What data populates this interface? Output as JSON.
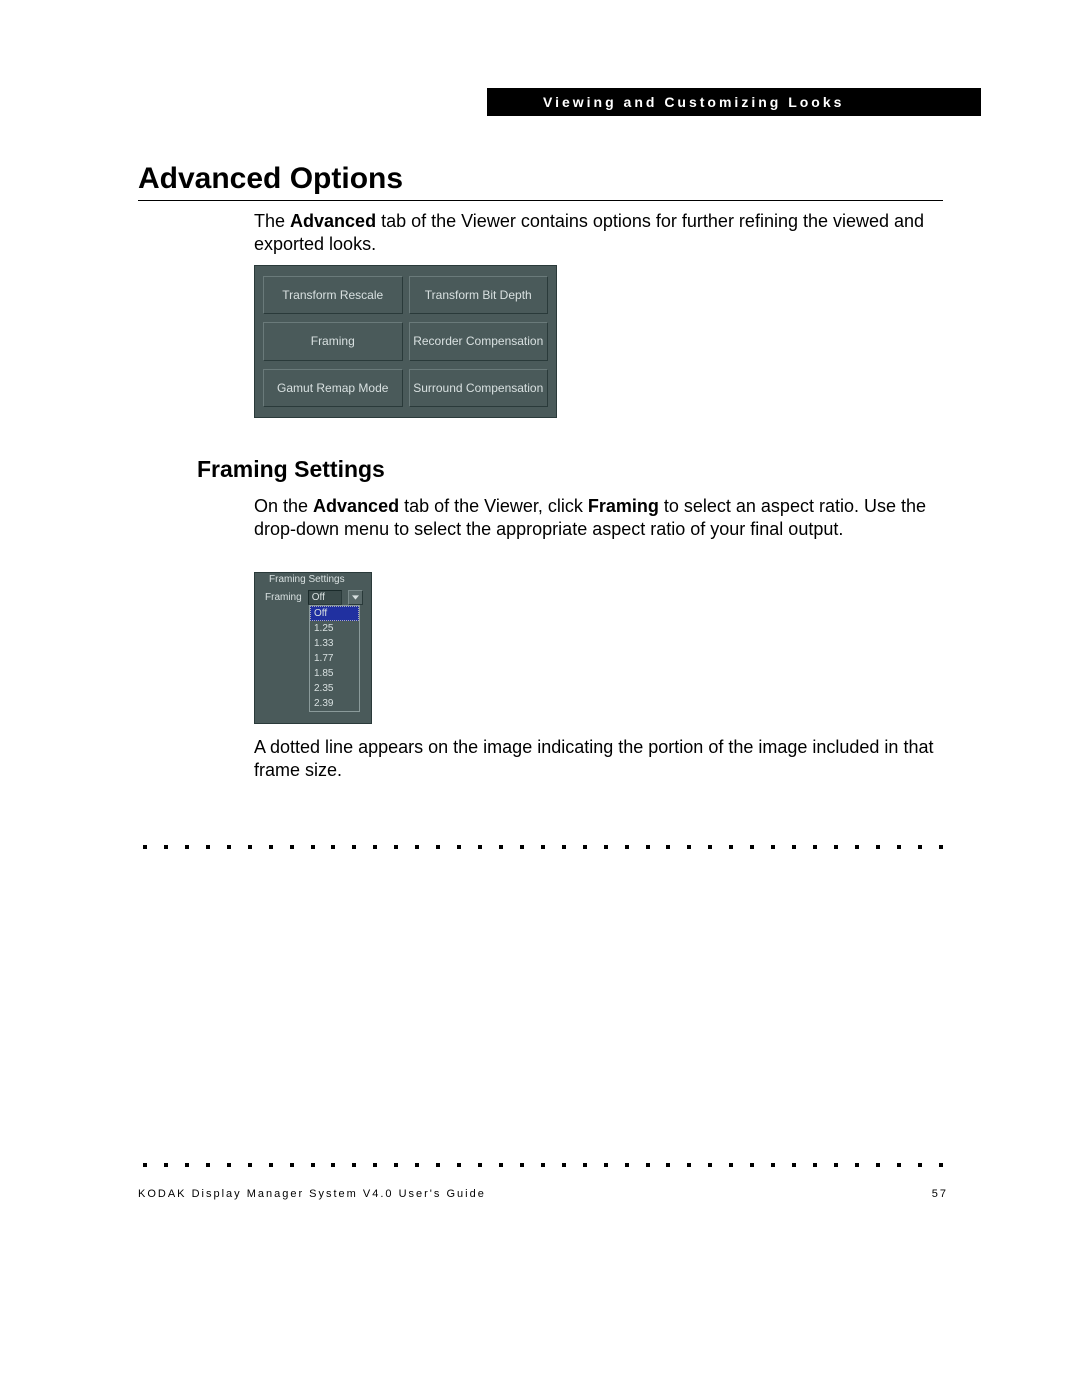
{
  "header": {
    "chapter": "Viewing and Customizing Looks"
  },
  "section1": {
    "title": "Advanced Options",
    "intro_pre": "The ",
    "intro_bold": "Advanced",
    "intro_post": " tab of the Viewer contains options for further refining the viewed and exported looks."
  },
  "grid": {
    "btn_tl": "Transform Rescale",
    "btn_tr": "Transform Bit Depth",
    "btn_ml": "Framing",
    "btn_mr": "Recorder Compensation",
    "btn_bl": "Gamut Remap Mode",
    "btn_br": "Surround Compensation"
  },
  "section2": {
    "title": "Framing Settings",
    "p_pre": "On the ",
    "p_b1": "Advanced",
    "p_mid": " tab of the Viewer, click ",
    "p_b2": "Framing",
    "p_post": " to select an aspect ratio. Use the drop-down menu to select the appropriate aspect ratio of your final output."
  },
  "framing": {
    "legend": "Framing Settings",
    "label": "Framing",
    "value": "Off",
    "options": {
      "o0": "Off",
      "o1": "1.25",
      "o2": "1.33",
      "o3": "1.77",
      "o4": "1.85",
      "o5": "2.35",
      "o6": "2.39"
    }
  },
  "para3": "A dotted line appears on the image indicating the portion of the image included in that frame size.",
  "footer": {
    "left": "KODAK Display Manager System V4.0 User's Guide",
    "page": "57"
  }
}
